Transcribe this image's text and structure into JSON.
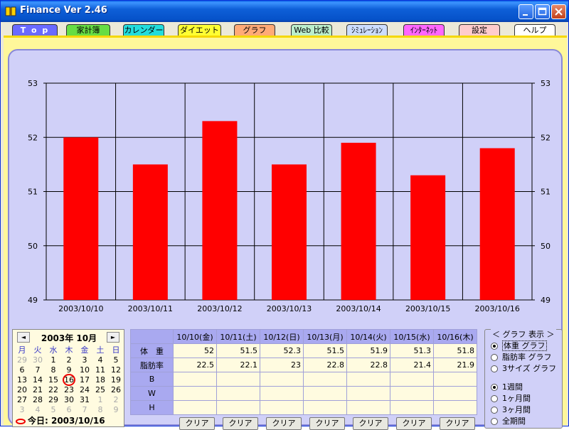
{
  "window": {
    "title": "Finance  Ver 2.46"
  },
  "tabs": [
    {
      "label": "T o p",
      "color": "#6a6aff",
      "text_color": "#ffffff"
    },
    {
      "label": "家計簿",
      "color": "#66dd44",
      "text_color": "#000000"
    },
    {
      "label": "カレンダー",
      "color": "#22dddd",
      "text_color": "#000000"
    },
    {
      "label": "ダイエット",
      "color": "#ffff33",
      "text_color": "#000000"
    },
    {
      "label": "グラフ",
      "color": "#ffaa77",
      "text_color": "#000000"
    },
    {
      "label": "Web 比較",
      "color": "#bbeecc",
      "text_color": "#000000"
    },
    {
      "label": "ｼﾐｭﾚｰｼｮﾝ",
      "color": "#ccddff",
      "text_color": "#000000"
    },
    {
      "label": "ｲﾝﾀｰﾈｯﾄ",
      "color": "#ff66ff",
      "text_color": "#000000"
    },
    {
      "label": "設定",
      "color": "#ffcccc",
      "text_color": "#000000"
    },
    {
      "label": "ヘルプ",
      "color": "#ffffff",
      "text_color": "#000000"
    }
  ],
  "chart_data": {
    "type": "bar",
    "categories": [
      "2003/10/10",
      "2003/10/11",
      "2003/10/12",
      "2003/10/13",
      "2003/10/14",
      "2003/10/15",
      "2003/10/16"
    ],
    "values": [
      52,
      51.5,
      52.3,
      51.5,
      51.9,
      51.3,
      51.8
    ],
    "ylim": [
      49,
      53
    ],
    "yticks": [
      49,
      50,
      51,
      52,
      53
    ],
    "bar_color": "#ff0000",
    "grid": true,
    "title": "",
    "xlabel": "",
    "ylabel": ""
  },
  "calendar": {
    "title": "2003年 10月",
    "prev": "◄",
    "next": "►",
    "weekdays": [
      "月",
      "火",
      "水",
      "木",
      "金",
      "土",
      "日"
    ],
    "weeks": [
      [
        {
          "d": "29",
          "dim": true
        },
        {
          "d": "30",
          "dim": true
        },
        {
          "d": "1"
        },
        {
          "d": "2"
        },
        {
          "d": "3"
        },
        {
          "d": "4"
        },
        {
          "d": "5"
        }
      ],
      [
        {
          "d": "6"
        },
        {
          "d": "7"
        },
        {
          "d": "8"
        },
        {
          "d": "9"
        },
        {
          "d": "10"
        },
        {
          "d": "11"
        },
        {
          "d": "12"
        }
      ],
      [
        {
          "d": "13"
        },
        {
          "d": "14"
        },
        {
          "d": "15"
        },
        {
          "d": "16",
          "today": true
        },
        {
          "d": "17"
        },
        {
          "d": "18"
        },
        {
          "d": "19"
        }
      ],
      [
        {
          "d": "20"
        },
        {
          "d": "21"
        },
        {
          "d": "22"
        },
        {
          "d": "23"
        },
        {
          "d": "24"
        },
        {
          "d": "25"
        },
        {
          "d": "26"
        }
      ],
      [
        {
          "d": "27"
        },
        {
          "d": "28"
        },
        {
          "d": "29"
        },
        {
          "d": "30"
        },
        {
          "d": "31"
        },
        {
          "d": "1",
          "dim": true
        },
        {
          "d": "2",
          "dim": true
        }
      ],
      [
        {
          "d": "3",
          "dim": true
        },
        {
          "d": "4",
          "dim": true
        },
        {
          "d": "5",
          "dim": true
        },
        {
          "d": "6",
          "dim": true
        },
        {
          "d": "7",
          "dim": true
        },
        {
          "d": "8",
          "dim": true
        },
        {
          "d": "9",
          "dim": true
        }
      ]
    ],
    "today_label": "今日: 2003/10/16"
  },
  "table": {
    "dates": [
      "10/10(金)",
      "10/11(土)",
      "10/12(日)",
      "10/13(月)",
      "10/14(火)",
      "10/15(水)",
      "10/16(木)"
    ],
    "rows": [
      {
        "label": "体　重",
        "values": [
          "52",
          "51.5",
          "52.3",
          "51.5",
          "51.9",
          "51.3",
          "51.8"
        ]
      },
      {
        "label": "脂肪率",
        "values": [
          "22.5",
          "22.1",
          "23",
          "22.8",
          "22.8",
          "21.4",
          "21.9"
        ]
      },
      {
        "label": "B",
        "values": [
          "",
          "",
          "",
          "",
          "",
          "",
          ""
        ]
      },
      {
        "label": "W",
        "values": [
          "",
          "",
          "",
          "",
          "",
          "",
          ""
        ]
      },
      {
        "label": "H",
        "values": [
          "",
          "",
          "",
          "",
          "",
          "",
          ""
        ]
      }
    ],
    "clear_label": "クリア"
  },
  "options": {
    "title": "＜ グラフ 表示 ＞",
    "graph_types": [
      {
        "label": "体重 グラフ",
        "checked": true
      },
      {
        "label": "脂肪率 グラフ",
        "checked": false
      },
      {
        "label": "3サイズ グラフ",
        "checked": false
      }
    ],
    "periods": [
      {
        "label": "1週間",
        "checked": true
      },
      {
        "label": "1ヶ月間",
        "checked": false
      },
      {
        "label": "3ヶ月間",
        "checked": false
      },
      {
        "label": "全期間",
        "checked": false
      }
    ]
  }
}
